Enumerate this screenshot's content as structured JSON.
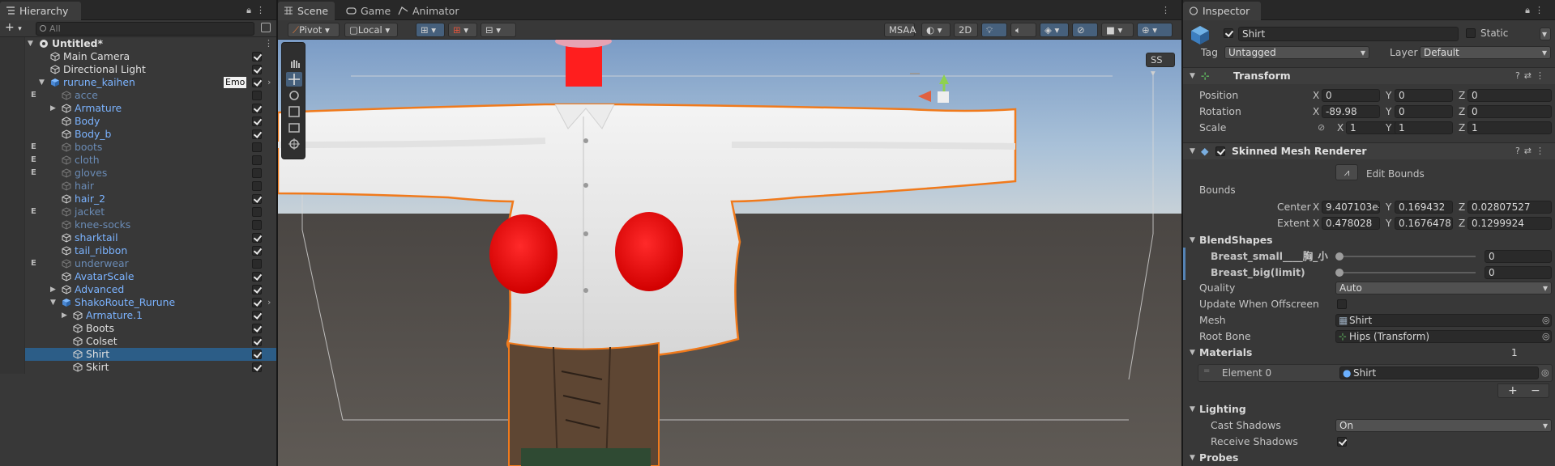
{
  "hierarchy": {
    "tab_label": "Hierarchy",
    "search_placeholder": "All",
    "emo_badge": "Emo",
    "items": [
      {
        "label": "Untitled*",
        "indent": 0,
        "type": "scene",
        "color": "white",
        "check": false,
        "expanded": true,
        "bold": true,
        "em": false
      },
      {
        "label": "Main Camera",
        "indent": 1,
        "type": "obj",
        "color": "white",
        "check": true,
        "em": false
      },
      {
        "label": "Directional Light",
        "indent": 1,
        "type": "obj",
        "color": "white",
        "check": true,
        "em": false
      },
      {
        "label": "rurune_kaihen",
        "indent": 1,
        "type": "prefab",
        "color": "blue",
        "check": true,
        "expanded": true,
        "em": false,
        "badge": true,
        "chev": true
      },
      {
        "label": "acce",
        "indent": 2,
        "type": "obj",
        "color": "dim",
        "check": false,
        "em": true
      },
      {
        "label": "Armature",
        "indent": 2,
        "type": "obj",
        "color": "blue",
        "check": true,
        "collapsed": true,
        "em": false
      },
      {
        "label": "Body",
        "indent": 2,
        "type": "obj",
        "color": "blue",
        "check": true,
        "em": false
      },
      {
        "label": "Body_b",
        "indent": 2,
        "type": "obj",
        "color": "blue",
        "check": true,
        "em": false
      },
      {
        "label": "boots",
        "indent": 2,
        "type": "obj",
        "color": "dim",
        "check": false,
        "em": true
      },
      {
        "label": "cloth",
        "indent": 2,
        "type": "obj",
        "color": "dim",
        "check": false,
        "em": true
      },
      {
        "label": "gloves",
        "indent": 2,
        "type": "obj",
        "color": "dim",
        "check": false,
        "em": true
      },
      {
        "label": "hair",
        "indent": 2,
        "type": "obj",
        "color": "dim",
        "check": false,
        "em": false
      },
      {
        "label": "hair_2",
        "indent": 2,
        "type": "obj",
        "color": "blue",
        "check": true,
        "em": false
      },
      {
        "label": "jacket",
        "indent": 2,
        "type": "obj",
        "color": "dim",
        "check": false,
        "em": true
      },
      {
        "label": "knee-socks",
        "indent": 2,
        "type": "obj",
        "color": "dim",
        "check": false,
        "em": false
      },
      {
        "label": "sharktail",
        "indent": 2,
        "type": "obj",
        "color": "blue",
        "check": true,
        "em": false
      },
      {
        "label": "tail_ribbon",
        "indent": 2,
        "type": "obj",
        "color": "blue",
        "check": true,
        "em": false
      },
      {
        "label": "underwear",
        "indent": 2,
        "type": "obj",
        "color": "dim",
        "check": false,
        "em": true
      },
      {
        "label": "AvatarScale",
        "indent": 2,
        "type": "obj",
        "color": "blue",
        "check": true,
        "em": false
      },
      {
        "label": "Advanced",
        "indent": 2,
        "type": "obj",
        "color": "blue",
        "check": true,
        "collapsed": true,
        "em": false
      },
      {
        "label": "ShakoRoute_Rurune",
        "indent": 2,
        "type": "prefab",
        "color": "blue",
        "check": true,
        "expanded": true,
        "em": false,
        "chev": true
      },
      {
        "label": "Armature.1",
        "indent": 3,
        "type": "obj",
        "color": "blue",
        "check": true,
        "collapsed": true,
        "em": false
      },
      {
        "label": "Boots",
        "indent": 3,
        "type": "obj",
        "color": "white",
        "check": true,
        "em": false
      },
      {
        "label": "Colset",
        "indent": 3,
        "type": "obj",
        "color": "white",
        "check": true,
        "em": false
      },
      {
        "label": "Shirt",
        "indent": 3,
        "type": "obj",
        "color": "white",
        "check": true,
        "em": false,
        "selected": true
      },
      {
        "label": "Skirt",
        "indent": 3,
        "type": "obj",
        "color": "white",
        "check": true,
        "em": false
      }
    ]
  },
  "scene": {
    "tabs": [
      "Scene",
      "Game",
      "Animator"
    ],
    "pivot": "Pivot",
    "local": "Local",
    "msaa": "MSAA",
    "mode_2d": "2D",
    "ss": "SS"
  },
  "inspector": {
    "tab_label": "Inspector",
    "object_name": "Shirt",
    "static_label": "Static",
    "tag_label": "Tag",
    "tag_value": "Untagged",
    "layer_label": "Layer",
    "layer_value": "Default",
    "transform": {
      "title": "Transform",
      "position_label": "Position",
      "rotation_label": "Rotation",
      "scale_label": "Scale",
      "position": {
        "x": "0",
        "y": "0",
        "z": "0"
      },
      "rotation": {
        "x": "-89.98",
        "y": "0",
        "z": "0"
      },
      "scale": {
        "x": "1",
        "y": "1",
        "z": "1"
      }
    },
    "smr": {
      "title": "Skinned Mesh Renderer",
      "edit_bounds": "Edit Bounds",
      "bounds_label": "Bounds",
      "center_label": "Center",
      "extent_label": "Extent",
      "center": {
        "x": "9.407103e-",
        "y": "0.169432",
        "z": "0.02807527"
      },
      "extent": {
        "x": "0.478028",
        "y": "0.1676478",
        "z": "0.1299924"
      },
      "blendshapes_label": "BlendShapes",
      "blendshapes": [
        {
          "name": "Breast_small____胸_小",
          "value": "0",
          "level": 0
        },
        {
          "name": "Breast_big(limit)",
          "value": "0",
          "level": 0
        }
      ],
      "quality_label": "Quality",
      "quality_value": "Auto",
      "update_offscreen_label": "Update When Offscreen",
      "mesh_label": "Mesh",
      "mesh_value": "Shirt",
      "root_bone_label": "Root Bone",
      "root_bone_value": "Hips (Transform)",
      "materials_label": "Materials",
      "materials_count": "1",
      "element0_label": "Element 0",
      "element0_value": "Shirt",
      "lighting_label": "Lighting",
      "cast_shadows_label": "Cast Shadows",
      "cast_shadows_value": "On",
      "receive_shadows_label": "Receive Shadows",
      "probes_label": "Probes"
    }
  }
}
